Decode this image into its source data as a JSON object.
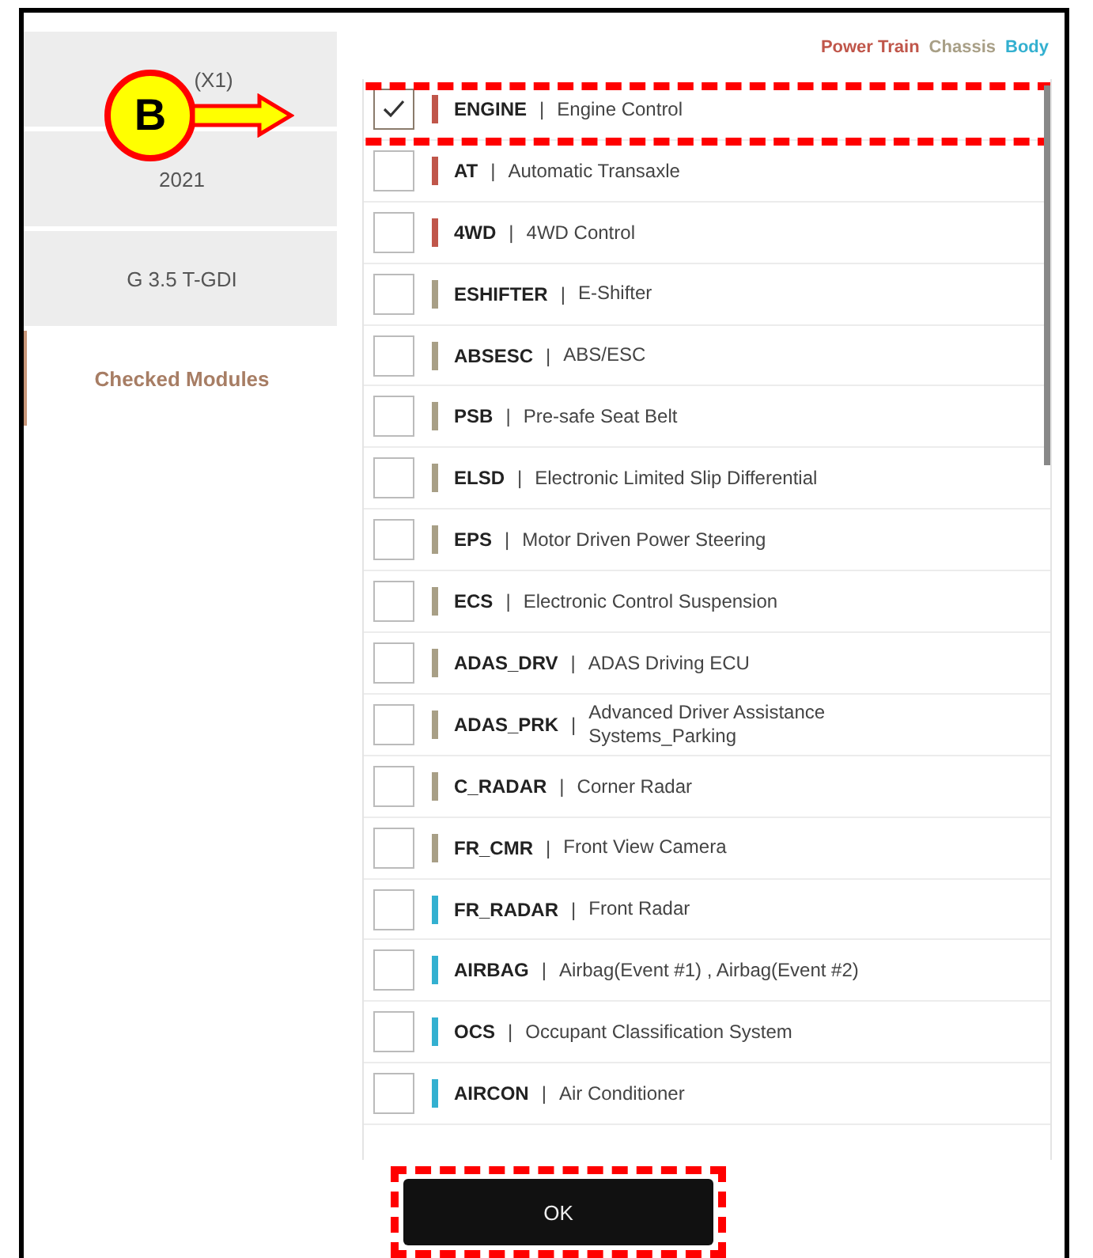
{
  "sidebar": {
    "items": [
      {
        "label": "(X1)",
        "selected": false
      },
      {
        "label": "2021",
        "selected": false
      },
      {
        "label": "G 3.5 T-GDI",
        "selected": false
      },
      {
        "label": "Checked Modules",
        "selected": true
      }
    ]
  },
  "legend": [
    {
      "label": "Power Train",
      "color": "#c0564a"
    },
    {
      "label": "Chassis",
      "color": "#a89f86"
    },
    {
      "label": "Body",
      "color": "#33b0d0"
    }
  ],
  "modules": [
    {
      "code": "ENGINE",
      "name": "Engine Control",
      "checked": true,
      "color": "#c0564a",
      "highlighted": true
    },
    {
      "code": "AT",
      "name": "Automatic Transaxle",
      "checked": false,
      "color": "#c0564a",
      "highlighted": false
    },
    {
      "code": "4WD",
      "name": "4WD Control",
      "checked": false,
      "color": "#c0564a",
      "highlighted": false
    },
    {
      "code": "ESHIFTER",
      "name": "E-Shifter",
      "checked": false,
      "color": "#a89f86",
      "highlighted": false
    },
    {
      "code": "ABSESC",
      "name": "ABS/ESC",
      "checked": false,
      "color": "#a89f86",
      "highlighted": false
    },
    {
      "code": "PSB",
      "name": "Pre-safe Seat Belt",
      "checked": false,
      "color": "#a89f86",
      "highlighted": false
    },
    {
      "code": "ELSD",
      "name": "Electronic Limited Slip Differential",
      "checked": false,
      "color": "#a89f86",
      "highlighted": false
    },
    {
      "code": "EPS",
      "name": "Motor Driven Power Steering",
      "checked": false,
      "color": "#a89f86",
      "highlighted": false
    },
    {
      "code": "ECS",
      "name": "Electronic Control Suspension",
      "checked": false,
      "color": "#a89f86",
      "highlighted": false
    },
    {
      "code": "ADAS_DRV",
      "name": "ADAS Driving ECU",
      "checked": false,
      "color": "#a89f86",
      "highlighted": false
    },
    {
      "code": "ADAS_PRK",
      "name": "Advanced Driver Assistance Systems_Parking",
      "checked": false,
      "color": "#a89f86",
      "highlighted": false
    },
    {
      "code": "C_RADAR",
      "name": "Corner Radar",
      "checked": false,
      "color": "#a89f86",
      "highlighted": false
    },
    {
      "code": "FR_CMR",
      "name": "Front View Camera",
      "checked": false,
      "color": "#a89f86",
      "highlighted": false
    },
    {
      "code": "FR_RADAR",
      "name": "Front Radar",
      "checked": false,
      "color": "#33b0d0",
      "highlighted": false
    },
    {
      "code": "AIRBAG",
      "name": "Airbag(Event #1) , Airbag(Event #2)",
      "checked": false,
      "color": "#33b0d0",
      "highlighted": false
    },
    {
      "code": "OCS",
      "name": "Occupant Classification System",
      "checked": false,
      "color": "#33b0d0",
      "highlighted": false
    },
    {
      "code": "AIRCON",
      "name": "Air Conditioner",
      "checked": false,
      "color": "#33b0d0",
      "highlighted": false
    }
  ],
  "separator": "|",
  "callout": {
    "label": "B"
  },
  "ok_button": {
    "label": "OK",
    "highlighted": true
  }
}
